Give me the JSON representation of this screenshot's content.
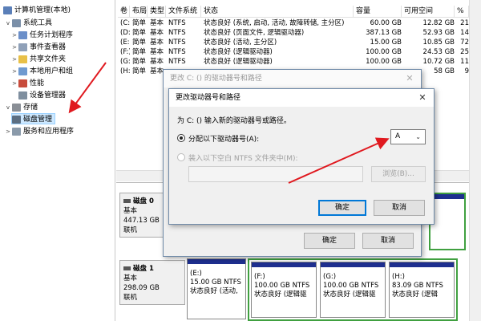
{
  "tree": {
    "items": [
      {
        "label": "计算机管理(本地)",
        "icon": "computer-management-icon"
      },
      {
        "label": "系统工具",
        "icon": "tools-icon"
      },
      {
        "label": "任务计划程序",
        "icon": "task-scheduler-icon"
      },
      {
        "label": "事件查看器",
        "icon": "event-viewer-icon"
      },
      {
        "label": "共享文件夹",
        "icon": "shared-folder-icon"
      },
      {
        "label": "本地用户和组",
        "icon": "users-icon"
      },
      {
        "label": "性能",
        "icon": "performance-icon"
      },
      {
        "label": "设备管理器",
        "icon": "device-manager-icon"
      },
      {
        "label": "存储",
        "icon": "storage-icon"
      },
      {
        "label": "磁盘管理",
        "icon": "disk-management-icon"
      },
      {
        "label": "服务和应用程序",
        "icon": "services-icon"
      }
    ]
  },
  "volumes": {
    "headers": [
      "卷",
      "布局",
      "类型",
      "文件系统",
      "状态",
      "容量",
      "可用空间",
      "%"
    ],
    "rows": [
      {
        "vol": "(C:)",
        "layout": "简单",
        "type": "基本",
        "fs": "NTFS",
        "status": "状态良好 (系统, 启动, 活动, 故障转储, 主分区)",
        "cap": "60.00 GB",
        "free": "12.82 GB",
        "pct": "21"
      },
      {
        "vol": "(D:)",
        "layout": "简单",
        "type": "基本",
        "fs": "NTFS",
        "status": "状态良好 (页面文件, 逻辑驱动器)",
        "cap": "387.13 GB",
        "free": "52.93 GB",
        "pct": "14"
      },
      {
        "vol": "(E:)",
        "layout": "简单",
        "type": "基本",
        "fs": "NTFS",
        "status": "状态良好 (活动, 主分区)",
        "cap": "15.00 GB",
        "free": "10.85 GB",
        "pct": "72"
      },
      {
        "vol": "(F:)",
        "layout": "简单",
        "type": "基本",
        "fs": "NTFS",
        "status": "状态良好 (逻辑驱动器)",
        "cap": "100.00 GB",
        "free": "24.53 GB",
        "pct": "25"
      },
      {
        "vol": "(G:)",
        "layout": "简单",
        "type": "基本",
        "fs": "NTFS",
        "status": "状态良好 (逻辑驱动器)",
        "cap": "100.00 GB",
        "free": "10.72 GB",
        "pct": "11"
      },
      {
        "vol": "(H:)",
        "layout": "简单",
        "type": "基本",
        "fs": "",
        "status": "",
        "cap": "",
        "free": "58 GB",
        "pct": "9"
      }
    ]
  },
  "disk0": {
    "name": "磁盘 0",
    "type": "基本",
    "size": "447.13 GB",
    "state": "联机"
  },
  "disk1": {
    "name": "磁盘 1",
    "type": "基本",
    "size": "298.09 GB",
    "state": "联机"
  },
  "disk1_parts": [
    {
      "drive": "(E:)",
      "size": "15.00 GB NTFS",
      "status": "状态良好 (活动,"
    },
    {
      "drive": "(F:)",
      "size": "100.00 GB NTFS",
      "status": "状态良好 (逻辑驱"
    },
    {
      "drive": "(G:)",
      "size": "100.00 GB NTFS",
      "status": "状态良好 (逻辑驱"
    },
    {
      "drive": "(H:)",
      "size": "83.09 GB NTFS",
      "status": "状态良好 (逻辑"
    }
  ],
  "outer_dialog": {
    "title": "更改 C: () 的驱动器号和路径",
    "ok": "确定",
    "cancel": "取消"
  },
  "inner_dialog": {
    "title": "更改驱动器号和路径",
    "prompt": "为 C: () 输入新的驱动器号或路径。",
    "assign_label": "分配以下驱动器号(A):",
    "selected_letter": "A",
    "mount_label": "装入以下空白 NTFS 文件夹中(M):",
    "browse": "浏览(B)...",
    "ok": "确定",
    "cancel": "取消"
  },
  "colors": {
    "primary_bar": "#1e2f8f",
    "logical_border": "#40a040",
    "arrow": "#e0191f"
  }
}
